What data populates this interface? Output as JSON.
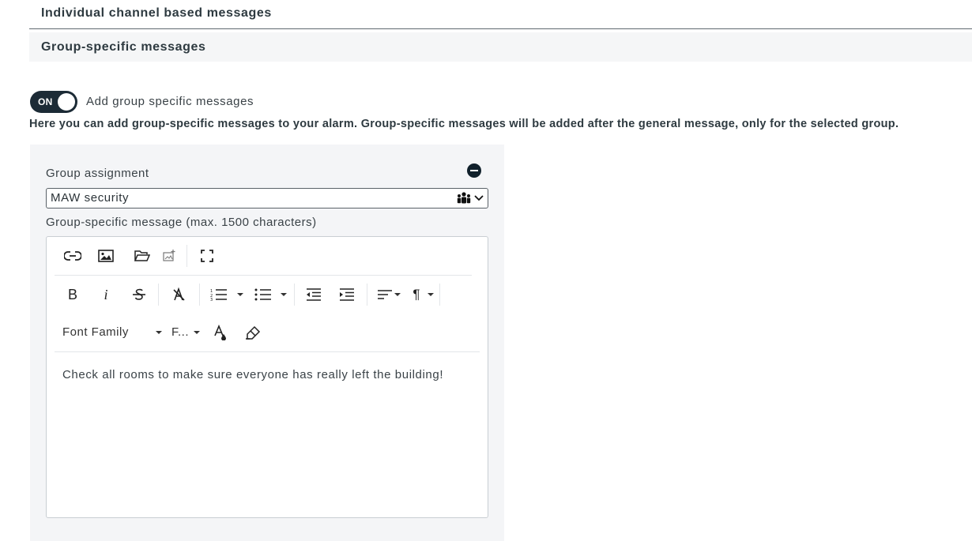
{
  "sections": {
    "individual_title": "Individual channel based messages",
    "group_title": "Group-specific messages"
  },
  "toggle": {
    "state_label": "ON",
    "caption": "Add group specific messages",
    "enabled": true
  },
  "info_text": "Here you can add group-specific messages to your alarm. Group-specific messages will be added after the general message, only for the selected group.",
  "group_panel": {
    "assignment_label": "Group assignment",
    "selected_group": "MAW security",
    "message_label": "Group-specific message (max. 1500 characters)"
  },
  "editor": {
    "toolbar_row1": [
      "link-icon",
      "image-icon",
      "folder-open-icon",
      "image-upload-icon",
      "fullscreen-icon"
    ],
    "toolbar_row2": [
      "bold-icon",
      "italic-icon",
      "strikethrough-icon",
      "clear-format-icon",
      "ordered-list-icon",
      "unordered-list-icon",
      "outdent-icon",
      "indent-icon",
      "align-icon",
      "paragraph-format-icon"
    ],
    "font_family_label": "Font Family",
    "font_size_label": "F...",
    "content": "Check all rooms to make sure everyone has really left the building!"
  },
  "colors": {
    "toggle_bg": "#1c2b36",
    "panel_bg": "#f4f5f7",
    "header_bg": "#f5f6f7"
  }
}
